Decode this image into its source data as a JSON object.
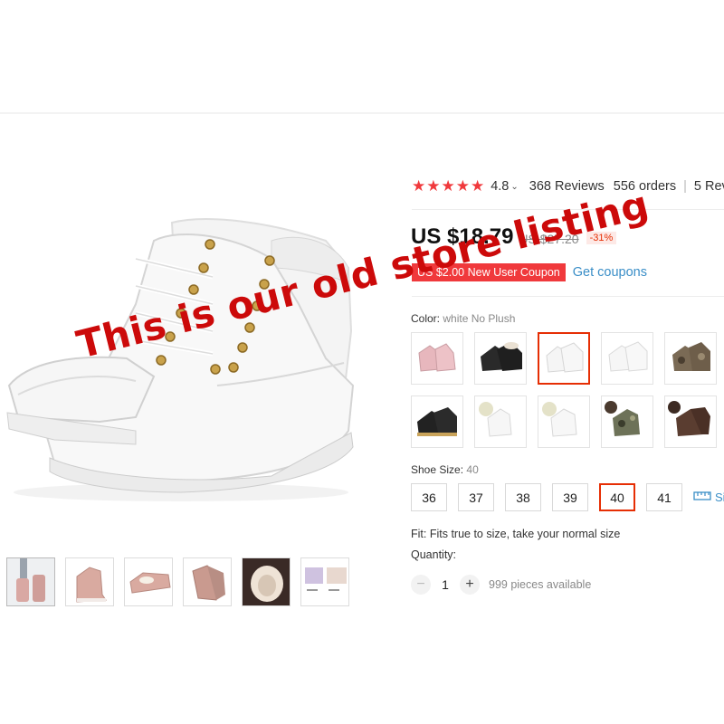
{
  "rating": {
    "stars": 4.8,
    "value": "4.8",
    "reviews": "368 Reviews",
    "orders": "556 orders",
    "more": "5 Revi"
  },
  "price": {
    "current": "US $18.79",
    "original": "US $27.20",
    "discount": "-31%"
  },
  "coupon": {
    "label": "US $2.00 New User Coupon",
    "link": "Get coupons"
  },
  "color": {
    "label": "Color:",
    "value": "white No Plush",
    "options": [
      "pink",
      "black-fur",
      "white",
      "white-2",
      "camo-brown",
      "black-yellow",
      "white-plush",
      "white-plush-2",
      "camo-green",
      "brown"
    ],
    "selected_index": 2
  },
  "size": {
    "label": "Shoe Size:",
    "value": "40",
    "options": [
      "36",
      "37",
      "38",
      "39",
      "40",
      "41"
    ],
    "selected_index": 4,
    "guide": "Si"
  },
  "fit": "Fit: Fits true to size, take your normal size",
  "quantity": {
    "label": "Quantity:",
    "value": "1",
    "available": "999 pieces available"
  },
  "watermark": "This is our old store listing",
  "colors": {
    "accent_red": "#e62e04",
    "star_red": "#f0393c",
    "link_blue": "#3a8ec7",
    "watermark_red": "#cc0a0a"
  }
}
